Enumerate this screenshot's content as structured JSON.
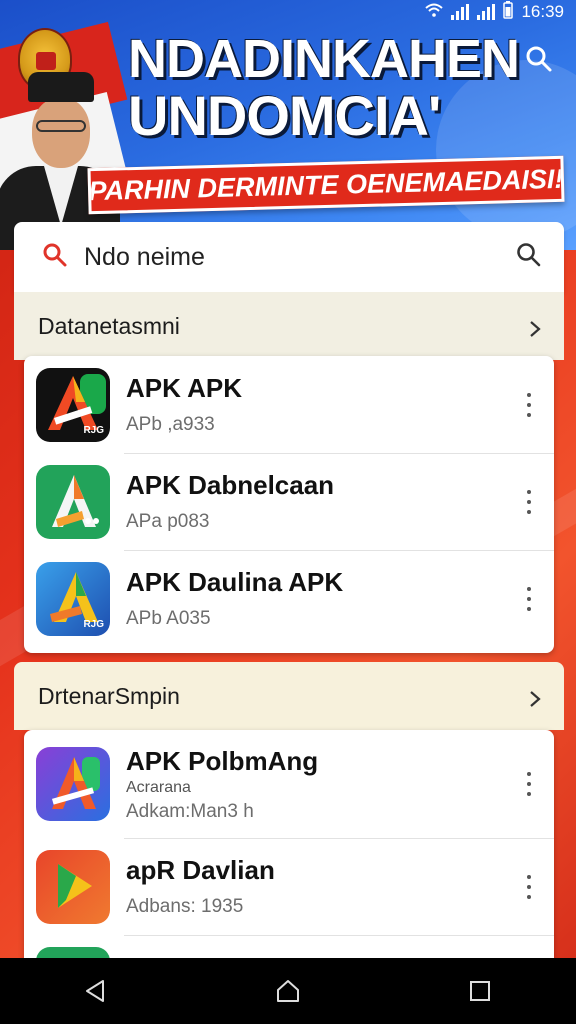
{
  "status_bar": {
    "time": "16:39"
  },
  "banner": {
    "headline_line1": "NDADINKAHEN",
    "headline_line2": "UNDOMCIA'",
    "ribbon_text": "PARHIN DERMINTE OENEMAEDAISI!"
  },
  "search": {
    "query": "Ndo neime"
  },
  "sections": [
    {
      "title": "Datanetasmni",
      "apps": [
        {
          "name": "APK APK",
          "subtitle": "APb ,а933",
          "icon_tag": "RJG",
          "icon_colors": [
            "#111111",
            "#1aa84a"
          ]
        },
        {
          "name": "APK Dabnelcaan",
          "subtitle": "APa р083",
          "icon_tag": "",
          "icon_colors": [
            "#2aa860",
            "#1d8f4d"
          ]
        },
        {
          "name": "APK Daulina APK",
          "subtitle": "APb A035",
          "icon_tag": "RJG",
          "icon_colors": [
            "#2f8fe0",
            "#1e4fb0"
          ]
        }
      ]
    },
    {
      "title": "DrtenarSmpin",
      "apps": [
        {
          "name": "APK PolbmAng",
          "subtitle_small": "Acrarana",
          "subtitle": "Adkam:Man3 h",
          "icon_tag": "",
          "icon_colors": [
            "#7a3fd0",
            "#2a6fe0"
          ]
        },
        {
          "name": "apR Davlian",
          "subtitle": "Adbans: 1935",
          "icon_tag": "",
          "icon_colors": [
            "#e84a2a",
            "#f07a30"
          ]
        }
      ]
    }
  ]
}
